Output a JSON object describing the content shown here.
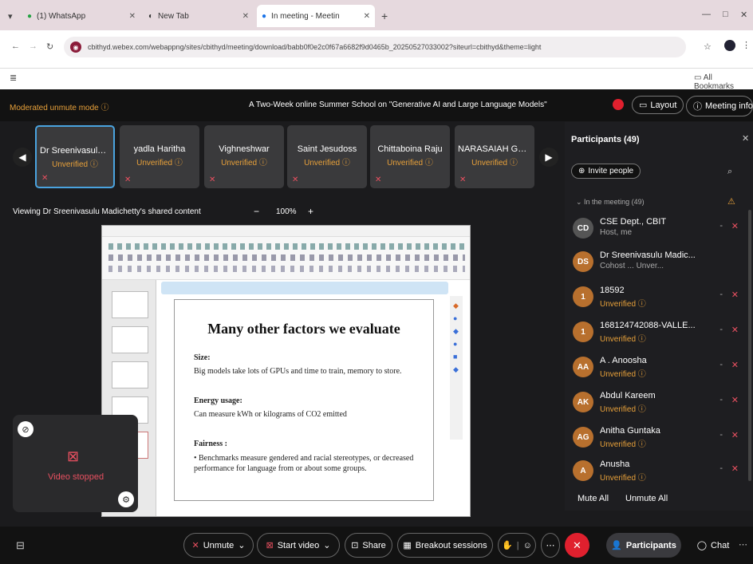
{
  "browser": {
    "tabs": [
      {
        "title": "(1) WhatsApp"
      },
      {
        "title": "New Tab"
      },
      {
        "title": "In meeting - Meeting - Web"
      }
    ],
    "url": "cbithyd.webex.com/webappng/sites/cbithyd/meeting/download/babb0f0e2c0f67a6682f9d0465b_20250527033002?siteurl=cbithyd&theme=light",
    "bookmarks_label": "All Bookmarks"
  },
  "meeting": {
    "unmute_mode": "Moderated unmute mode",
    "title": "A Two-Week online Summer School on \"Generative AI and Large Language Models\"",
    "layout_label": "Layout",
    "meeting_info_label": "Meeting info",
    "strip": [
      {
        "name": "Dr Sreenivasulu M...",
        "status": "Unverified"
      },
      {
        "name": "yadla Haritha",
        "status": "Unverified"
      },
      {
        "name": "Vighneshwar",
        "status": "Unverified"
      },
      {
        "name": "Saint Jesudoss",
        "status": "Unverified"
      },
      {
        "name": "Chittaboina Raju",
        "status": "Unverified"
      },
      {
        "name": "NARASAIAH GAL...",
        "status": "Unverified"
      }
    ],
    "viewing_label": "Viewing Dr Sreenivasulu Madichetty's shared content",
    "zoom": "100%",
    "self_view_label": "Video stopped"
  },
  "slide": {
    "title": "Many other factors we evaluate",
    "sections": [
      {
        "heading": "Size:",
        "text": "Big models take lots of GPUs and time to train, memory to store."
      },
      {
        "heading": "Energy usage:",
        "text": "Can measure kWh or kilograms of CO2 emitted"
      },
      {
        "heading": "Fairness :",
        "text": "Benchmarks measure gendered and racial stereotypes, or decreased performance for language from or about some groups."
      }
    ]
  },
  "panel": {
    "title": "Participants (49)",
    "invite_label": "Invite people",
    "section_label": "In the meeting (49)",
    "participants": [
      {
        "initials": "CD",
        "name": "CSE Dept., CBIT",
        "sub": "Host, me"
      },
      {
        "initials": "DS",
        "name": "Dr Sreenivasulu Madic...",
        "sub": "Cohost ... Unver..."
      },
      {
        "initials": "1",
        "name": "18592",
        "sub": "Unverified"
      },
      {
        "initials": "1",
        "name": "168124742088-VALLE...",
        "sub": "Unverified"
      },
      {
        "initials": "AA",
        "name": "A . Anoosha",
        "sub": "Unverified"
      },
      {
        "initials": "AK",
        "name": "Abdul Kareem",
        "sub": "Unverified"
      },
      {
        "initials": "AG",
        "name": "Anitha Guntaka",
        "sub": "Unverified"
      },
      {
        "initials": "A",
        "name": "Anusha",
        "sub": "Unverified"
      }
    ],
    "mute_all": "Mute All",
    "unmute_all": "Unmute All"
  },
  "controls": {
    "unmute": "Unmute",
    "start_video": "Start video",
    "share": "Share",
    "breakout": "Breakout sessions",
    "participants": "Participants",
    "chat": "Chat"
  },
  "colors": {
    "accent_red": "#e0202e",
    "warning_orange": "#e8a13a"
  }
}
